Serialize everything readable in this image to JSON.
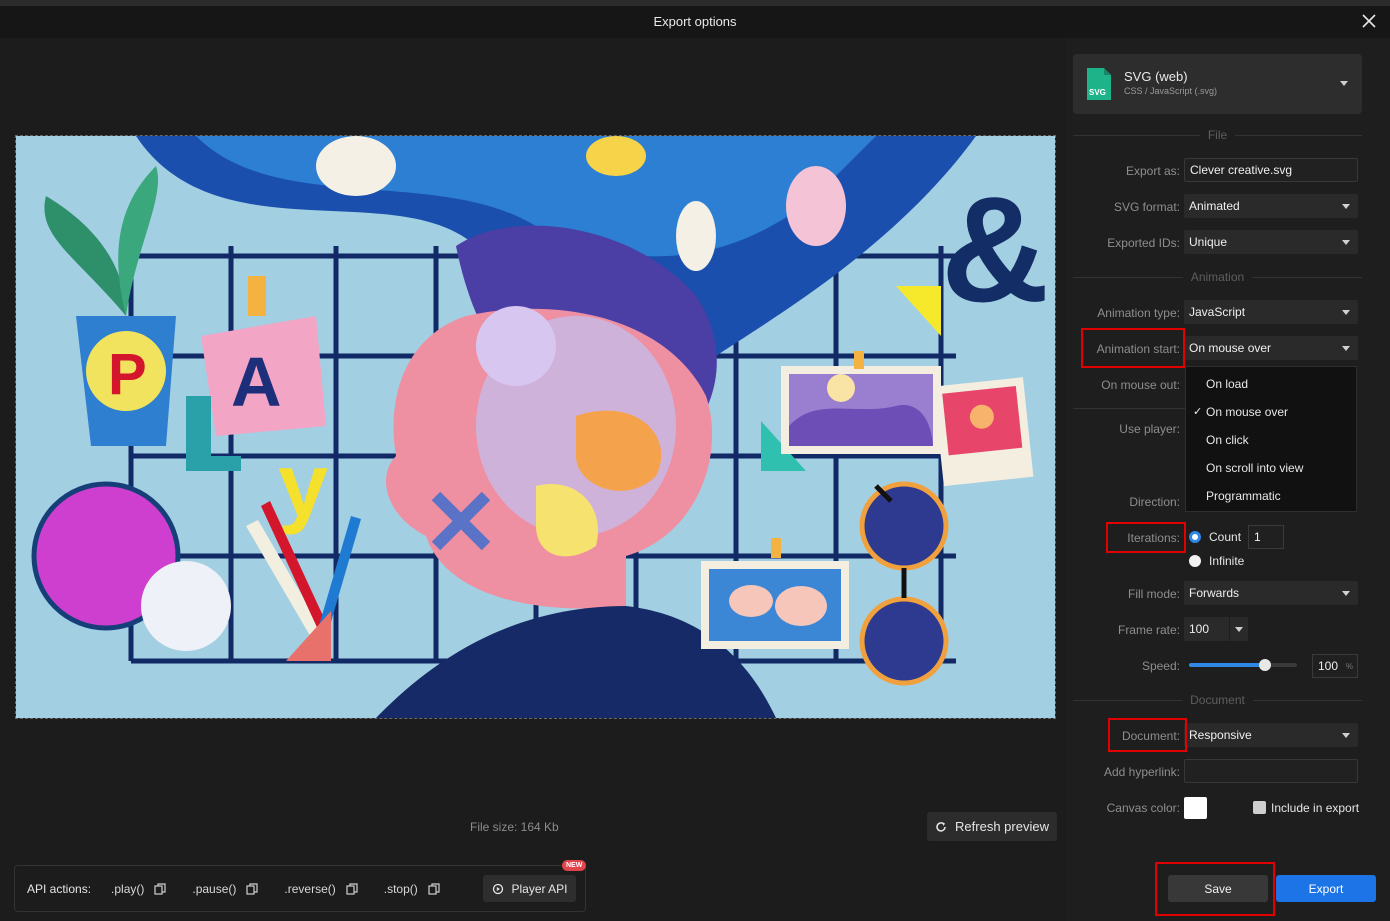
{
  "window": {
    "title": "Export options"
  },
  "format": {
    "name": "SVG (web)",
    "subtitle": "CSS / JavaScript (.svg)",
    "icon": "svg-file-icon",
    "badge_text": "SVG"
  },
  "sections": {
    "file": "File",
    "animation": "Animation",
    "document": "Document"
  },
  "file": {
    "export_as_label": "Export as:",
    "export_as_value": "Clever creative.svg",
    "svg_format_label": "SVG format:",
    "svg_format_value": "Animated",
    "exported_ids_label": "Exported IDs:",
    "exported_ids_value": "Unique"
  },
  "animation": {
    "type_label": "Animation type:",
    "type_value": "JavaScript",
    "start_label": "Animation start:",
    "start_value": "On mouse over",
    "mouse_out_label": "On mouse out:",
    "use_player_label": "Use player:",
    "direction_label": "Direction:",
    "iterations_label": "Iterations:",
    "count_label": "Count",
    "count_value": "1",
    "infinite_label": "Infinite",
    "fill_mode_label": "Fill mode:",
    "fill_mode_value": "Forwards",
    "frame_rate_label": "Frame rate:",
    "frame_rate_value": "100",
    "speed_label": "Speed:",
    "speed_value": "100",
    "speed_unit": "%",
    "speed_fraction": 0.7
  },
  "start_dropdown": {
    "options": [
      "On load",
      "On mouse over",
      "On click",
      "On scroll into view",
      "Programmatic"
    ],
    "selected": "On mouse over"
  },
  "document": {
    "document_label": "Document:",
    "document_value": "Responsive",
    "hyperlink_label": "Add hyperlink:",
    "hyperlink_value": "",
    "canvas_color_label": "Canvas color:",
    "canvas_color": "#ffffff",
    "include_label": "Include in export"
  },
  "preview": {
    "file_size": "File size: 164 Kb",
    "refresh_label": "Refresh preview"
  },
  "api": {
    "label": "API actions:",
    "actions": [
      ".play()",
      ".pause()",
      ".reverse()",
      ".stop()"
    ],
    "player_api_label": "Player API",
    "new_badge": "NEW"
  },
  "buttons": {
    "save": "Save",
    "export": "Export"
  },
  "colors": {
    "accent": "#1d74e6",
    "highlight_red": "#e30000",
    "svg_badge": "#1fb38a"
  }
}
